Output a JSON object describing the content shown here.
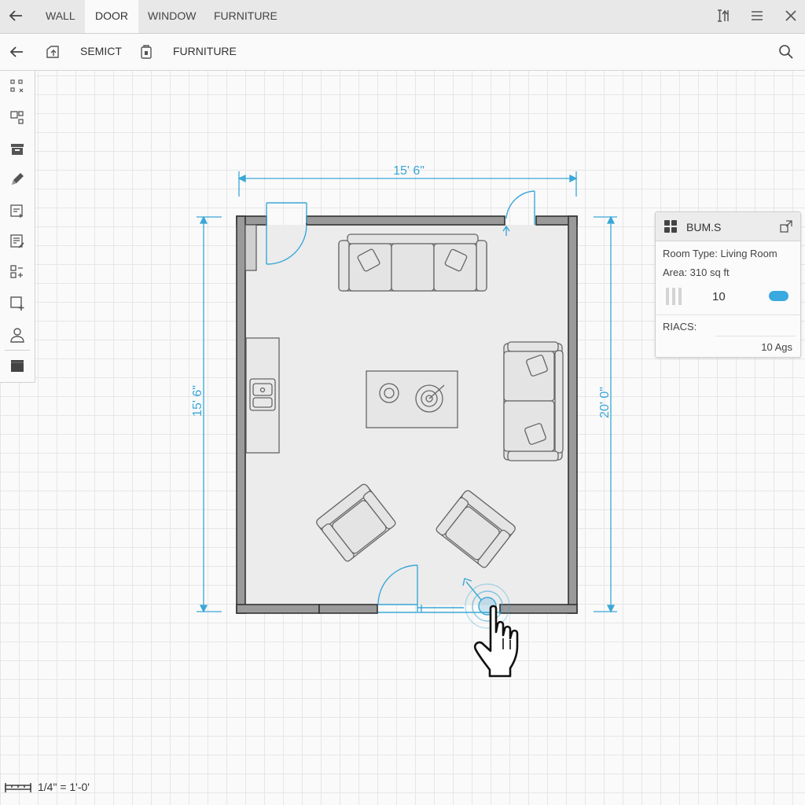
{
  "tabbar": {
    "tabs": [
      {
        "label": "WALL",
        "active": false
      },
      {
        "label": "DOOR",
        "active": true
      },
      {
        "label": "WINDOW",
        "active": false
      },
      {
        "label": "FURNITURE",
        "active": false
      }
    ],
    "icons": [
      "back-arrow-icon",
      "split-view-icon",
      "menu-icon",
      "close-icon"
    ]
  },
  "toolbar": {
    "select_label": "SEMICT",
    "furniture_label": "FURNITURE",
    "icons": [
      "back-arrow-icon",
      "select-tool-icon",
      "furniture-icon",
      "search-icon"
    ]
  },
  "rail": {
    "tools": [
      "node-grid-icon",
      "group-icon",
      "storage-icon",
      "pencil-icon",
      "add-note-icon",
      "edit-sheet-icon",
      "align-add-icon",
      "add-frame-icon",
      "person-icon",
      "fill-block-icon"
    ]
  },
  "plan": {
    "dim_top": "15' 6\"",
    "dim_left": "15' 6\"",
    "dim_right": "20' 0\""
  },
  "panel": {
    "title": "BUM.S",
    "room_type": "Room Type: Living Room",
    "area": "Area: 310 sq ft",
    "slider_value": "10",
    "toggle_on": true,
    "section_label": "RIACS:",
    "footer_value": "10 Ags"
  },
  "footer": {
    "scale": "1/4\" = 1'-0'"
  },
  "colors": {
    "accent": "#3aa7d8",
    "wall": "#999999",
    "floor": "#ececec",
    "toggle": "#39a9e0"
  }
}
